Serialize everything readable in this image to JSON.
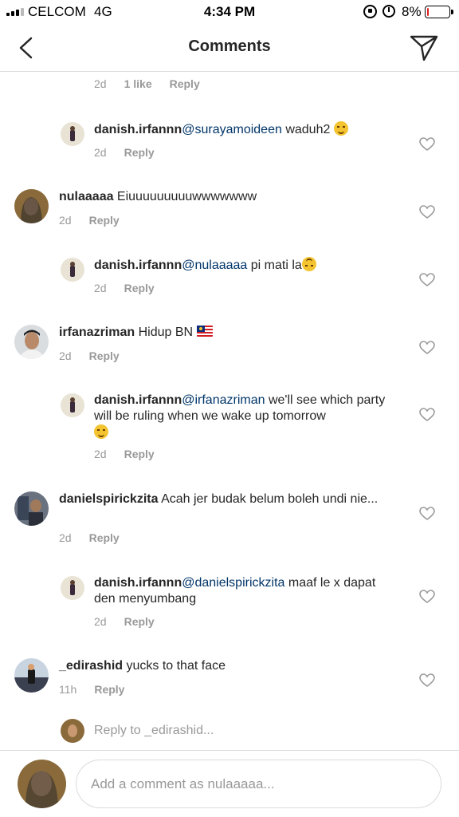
{
  "status_bar": {
    "carrier": "CELCOM",
    "network": "4G",
    "time": "4:34 PM",
    "battery_percent": "8%",
    "battery_level": 0.08,
    "battery_color": "#e02020"
  },
  "header": {
    "title": "Comments",
    "back_icon": "chevron-left-icon",
    "send_icon": "paper-plane-icon"
  },
  "comments": [
    {
      "meta": {
        "time": "2d",
        "likes": "1 like",
        "reply": "Reply"
      }
    },
    {
      "username": "danish.irfannn",
      "mention": "@surayamoideen",
      "text": " waduh2",
      "emoji": "shushing-face",
      "meta": {
        "time": "2d",
        "reply": "Reply"
      }
    },
    {
      "username": "nulaaaaa",
      "text": " Eiuuuuuuuuuwwwwwww",
      "meta": {
        "time": "2d",
        "reply": "Reply"
      }
    },
    {
      "username": "danish.irfannn",
      "mention": "@nulaaaaa",
      "text": " pi mati la",
      "emoji": "upside-down-face",
      "meta": {
        "time": "2d",
        "reply": "Reply"
      }
    },
    {
      "username": "irfanazriman",
      "text": " Hidup BN ",
      "emoji": "malaysia-flag",
      "meta": {
        "time": "2d",
        "reply": "Reply"
      }
    },
    {
      "username": "danish.irfannn",
      "mention": "@irfanazriman",
      "text": " we'll see which party will be ruling when we wake up tomorrow",
      "emoji": "relieved-face",
      "meta": {
        "time": "2d",
        "reply": "Reply"
      }
    },
    {
      "username": "danielspirickzita",
      "text": " Acah jer budak belum boleh undi nie...",
      "meta": {
        "time": "2d",
        "reply": "Reply"
      }
    },
    {
      "username": "danish.irfannn",
      "mention": "@danielspirickzita",
      "text": " maaf le x dapat den menyumbang",
      "meta": {
        "time": "2d",
        "reply": "Reply"
      }
    },
    {
      "username": "_edirashid",
      "text": " yucks to that face",
      "meta": {
        "time": "11h",
        "reply": "Reply"
      }
    }
  ],
  "heart_icon": "heart-outline-icon",
  "reply_to": {
    "text": "Reply to _edirashid..."
  },
  "composer": {
    "placeholder": "Add a comment as nulaaaaa..."
  },
  "colors": {
    "text": "#262626",
    "secondary": "#999999",
    "mention": "#003569",
    "divider": "#dbdbdb"
  }
}
